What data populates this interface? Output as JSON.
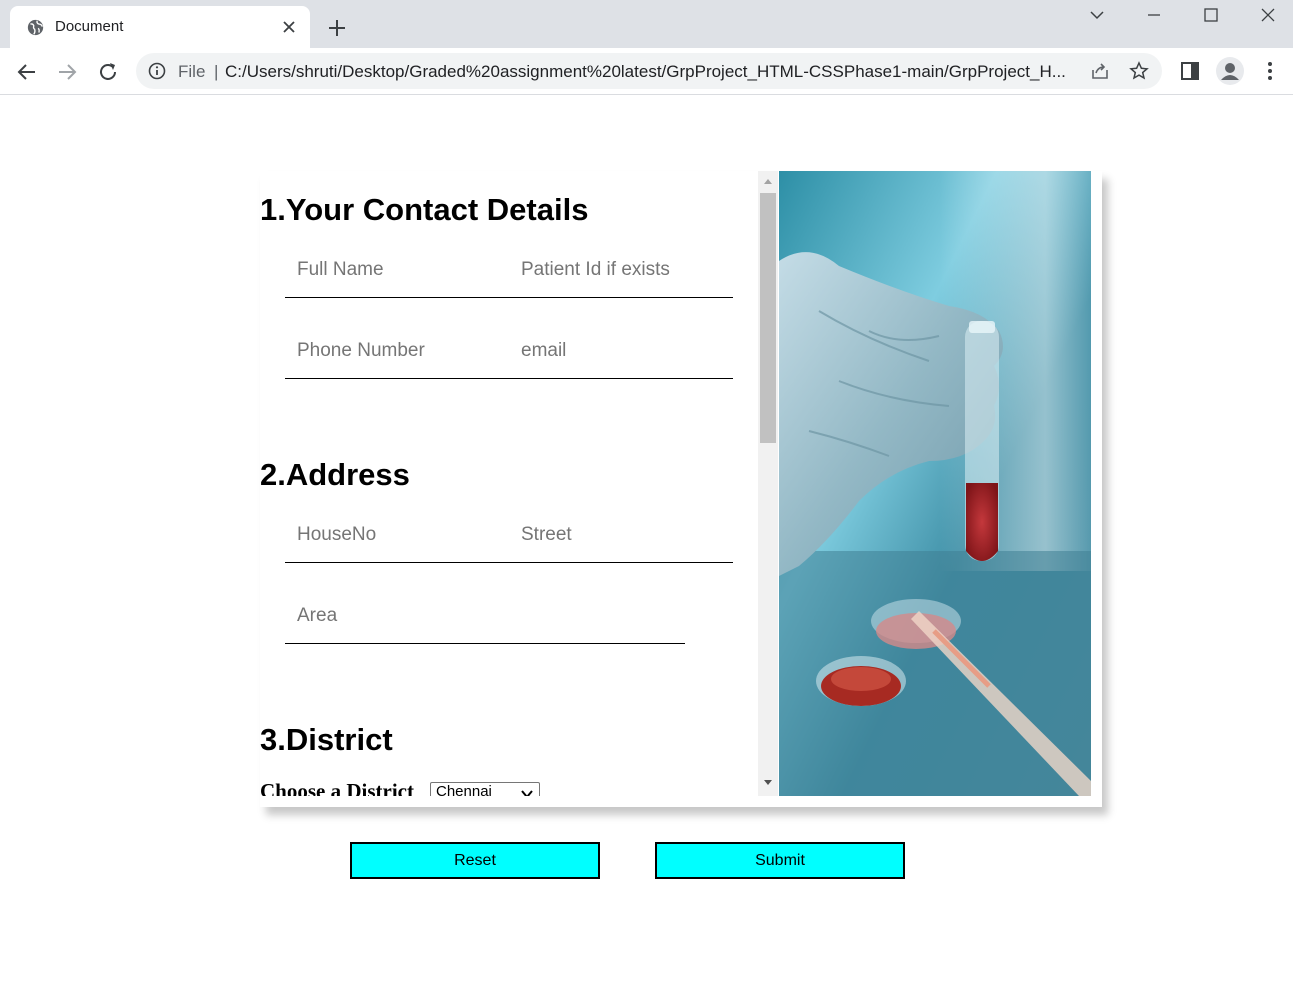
{
  "browser": {
    "tab_title": "Document",
    "scheme": "File",
    "separator": "|",
    "url": "C:/Users/shruti/Desktop/Graded%20assignment%20latest/GrpProject_HTML-CSSPhase1-main/GrpProject_H..."
  },
  "form": {
    "section1_title": "1.Your Contact Details",
    "full_name_placeholder": "Full Name",
    "patient_id_placeholder": "Patient Id if exists",
    "phone_placeholder": "Phone Number",
    "email_placeholder": "email",
    "section2_title": "2.Address",
    "house_placeholder": "HouseNo",
    "street_placeholder": "Street",
    "area_placeholder": "Area",
    "section3_title": "3.District",
    "district_label": "Choose a District",
    "district_value": "Chennai"
  },
  "buttons": {
    "reset": "Reset",
    "submit": "Submit"
  },
  "colors": {
    "button_bg": "#00ffff",
    "tabstrip_bg": "#dee1e6"
  }
}
